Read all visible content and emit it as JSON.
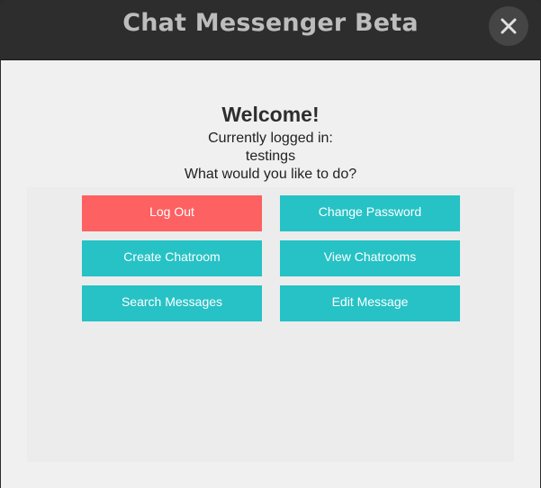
{
  "window": {
    "title": "Chat Messenger Beta",
    "close_icon": "close-icon"
  },
  "main": {
    "heading": "Welcome!",
    "logged_in_label": "Currently logged in:",
    "username": "testings",
    "prompt": "What would you like to do?"
  },
  "actions": {
    "log_out": "Log Out",
    "change_password": "Change Password",
    "create_chatroom": "Create Chatroom",
    "view_chatrooms": "View Chatrooms",
    "search_messages": "Search Messages",
    "edit_message": "Edit Message"
  },
  "colors": {
    "accent_teal": "#26c2c5",
    "danger_red": "#fd6161",
    "titlebar": "#2d2d2d",
    "background": "#f0f0f0"
  }
}
